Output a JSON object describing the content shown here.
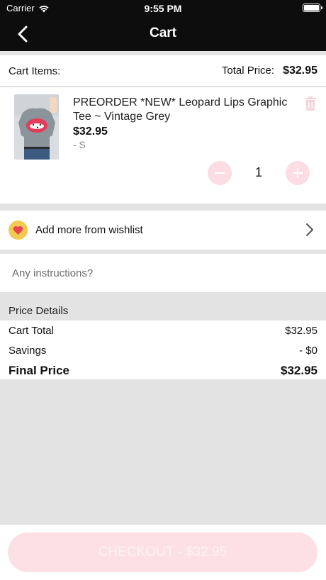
{
  "status_bar": {
    "carrier": "Carrier",
    "time": "9:55 PM"
  },
  "nav": {
    "title": "Cart",
    "back_icon": "chevron-left-icon"
  },
  "cart_header": {
    "items_label": "Cart Items:",
    "total_label": "Total Price:",
    "total_value": "$32.95"
  },
  "cart_items": [
    {
      "name": "PREORDER *NEW* Leopard Lips Graphic Tee ~ Vintage Grey",
      "price": "$32.95",
      "variant": "- S",
      "quantity": "1",
      "icons": {
        "delete": "trash-icon",
        "decrease": "minus-icon",
        "increase": "plus-icon"
      }
    }
  ],
  "wishlist": {
    "label": "Add more from wishlist",
    "icon": "heart-icon"
  },
  "instructions": {
    "placeholder": "Any instructions?"
  },
  "price_details": {
    "title": "Price Details",
    "rows": [
      {
        "label": "Cart Total",
        "value": "$32.95"
      },
      {
        "label": "Savings",
        "value": "- $0"
      },
      {
        "label": "Final Price",
        "value": "$32.95"
      }
    ]
  },
  "checkout": {
    "label": "CHECKOUT - $32.95"
  },
  "colors": {
    "accent_pink": "#fbdde3",
    "nav_bg": "#0d0d0d",
    "badge_yellow": "#f3c94f",
    "heart_red": "#e8454f"
  }
}
